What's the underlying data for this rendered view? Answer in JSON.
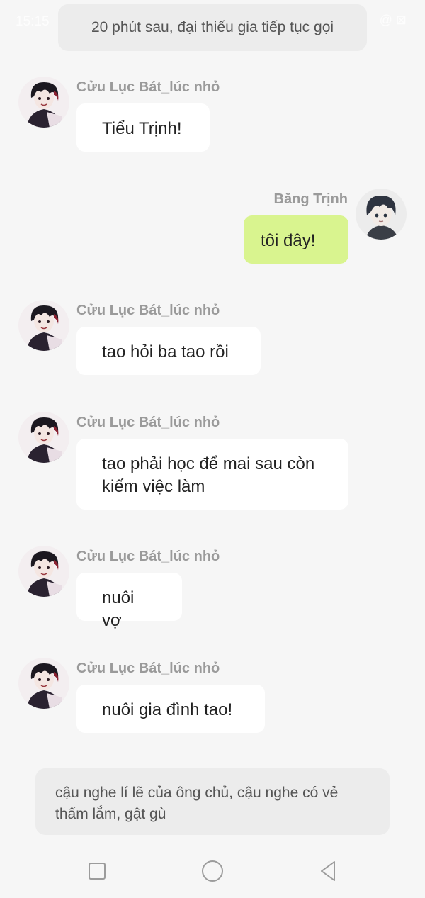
{
  "status_bar": {
    "time": "15:15",
    "wifi_icon": "wifi-icon",
    "right_icons": "@ ⊠"
  },
  "narration_top": "20 phút sau, đại thiếu gia tiếp tục gọi",
  "messages": [
    {
      "sender": "Cửu Lục Bát_lúc nhỏ",
      "text": "Tiểu Trịnh!",
      "side": "left"
    },
    {
      "sender": "Băng Trịnh",
      "text": "tôi đây!",
      "side": "right"
    },
    {
      "sender": "Cửu Lục Bát_lúc nhỏ",
      "text": "tao hỏi ba tao rồi",
      "side": "left"
    },
    {
      "sender": "Cửu Lục Bát_lúc nhỏ",
      "text": "tao phải học để mai sau còn kiếm việc làm",
      "side": "left"
    },
    {
      "sender": "Cửu Lục Bát_lúc nhỏ",
      "text": "nuôi vợ",
      "side": "left"
    },
    {
      "sender": "Cửu Lục Bát_lúc nhỏ",
      "text": "nuôi gia đình tao!",
      "side": "left"
    }
  ],
  "narration_bottom": "cậu nghe lí lẽ của ông chủ, cậu nghe có vẻ thấm lắm, gật gù",
  "nav": {
    "recent_icon": "square-icon",
    "home_icon": "circle-icon",
    "back_icon": "triangle-back-icon"
  },
  "colors": {
    "background": "#f6f6f6",
    "incoming_bubble": "#ffffff",
    "outgoing_bubble": "#d9f48f",
    "narration": "#ececec",
    "sender_name": "#9a9a9a"
  }
}
